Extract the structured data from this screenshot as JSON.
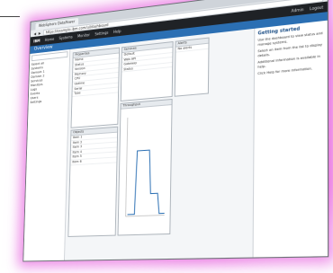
{
  "browser": {
    "tab_label": "WebSphere DataPower",
    "address": "https://example.ibm.com/ui/dashboard"
  },
  "nav": {
    "brand": "IBM",
    "items": [
      "Home",
      "Systems",
      "Monitor",
      "Settings",
      "Help"
    ],
    "right": [
      "Admin",
      "Logout"
    ]
  },
  "page": {
    "title": "Overview"
  },
  "left": {
    "search_placeholder": "Search",
    "items": [
      "Select all",
      "Systems",
      "Domain 1",
      "Domain 2",
      "Services",
      "Monitors",
      "Logs",
      "Events",
      "Users",
      "Settings"
    ]
  },
  "panels": {
    "p1": {
      "title": "Properties",
      "rows": [
        "Name",
        "Status",
        "Version",
        "Memory",
        "CPU",
        "Uptime",
        "Serial",
        "Type"
      ]
    },
    "p2": {
      "title": "Services",
      "rows": [
        "Default",
        "Web API",
        "Gateway",
        "Status"
      ]
    },
    "p3": {
      "title": "Alerts",
      "rows": [
        "No alerts"
      ]
    },
    "p4": {
      "title": "Objects",
      "rows": [
        "Item 1",
        "Item 2",
        "Item 3",
        "Item 4",
        "Item 5",
        "Item 6"
      ]
    },
    "p5": {
      "title": "Throughput",
      "rows": []
    }
  },
  "right": {
    "heading": "Getting started",
    "paragraphs": [
      "Use the dashboard to view status and manage systems.",
      "Select an item from the list to display details.",
      "Additional information is available in help.",
      "Click Help for more information."
    ]
  },
  "colors": {
    "accent": "#2b6fb3",
    "glow": "#e97ee0"
  }
}
